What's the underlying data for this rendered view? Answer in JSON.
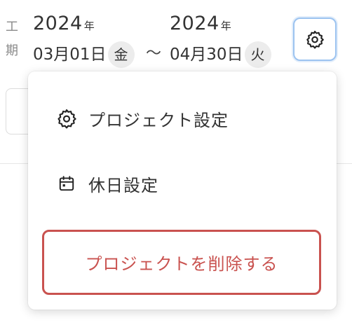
{
  "period": {
    "label": "工\n期",
    "start": {
      "year": "2024",
      "year_unit": "年",
      "month_day": "03月01日",
      "weekday": "金"
    },
    "separator": "～",
    "end": {
      "year": "2024",
      "year_unit": "年",
      "month_day": "04月30日",
      "weekday": "火"
    }
  },
  "settings_button": {
    "icon": "gear-icon"
  },
  "menu": {
    "items": [
      {
        "icon": "gear-icon",
        "label": "プロジェクト設定"
      },
      {
        "icon": "calendar-icon",
        "label": "休日設定"
      }
    ],
    "delete_label": "プロジェクトを削除する"
  },
  "colors": {
    "danger": "#c9524f",
    "focus_ring": "#9cc3f0",
    "badge_bg": "#ececec"
  }
}
